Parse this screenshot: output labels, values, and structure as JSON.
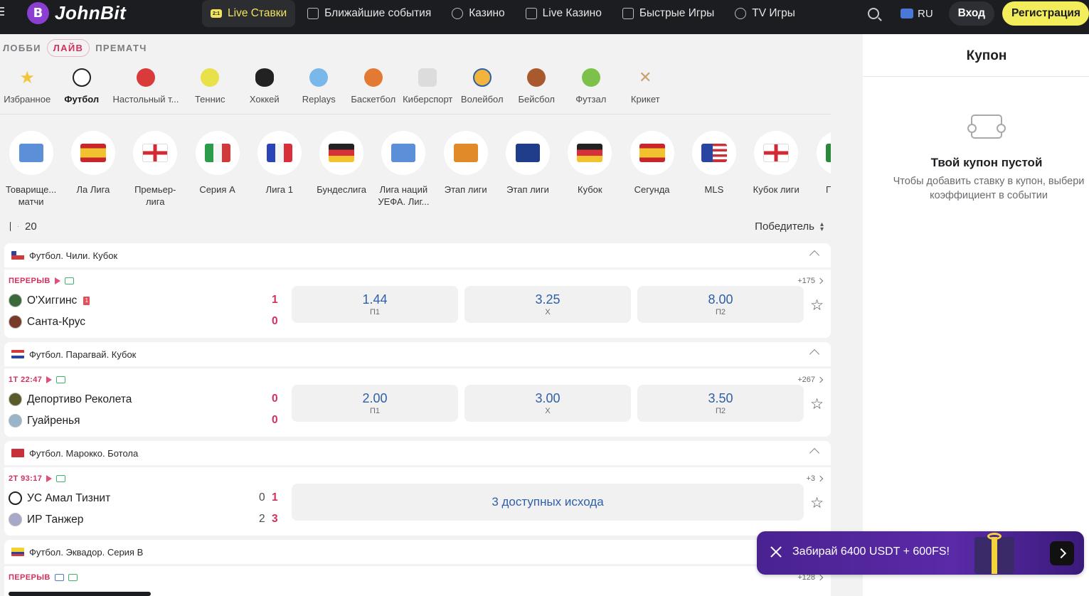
{
  "header": {
    "logo_text": "JohnBit",
    "nav": [
      {
        "label": "Live Ставки",
        "icon": "live-scoreboard-icon",
        "badge": "2:1",
        "active": true
      },
      {
        "label": "Ближайшие события",
        "icon": "calendar-icon"
      },
      {
        "label": "Казино",
        "icon": "casino-chip-icon"
      },
      {
        "label": "Live Казино",
        "icon": "live-casino-icon"
      },
      {
        "label": "Быстрые Игры",
        "icon": "rocket-icon"
      },
      {
        "label": "TV Игры",
        "icon": "tv-play-icon"
      }
    ],
    "language": "RU",
    "login_label": "Вход",
    "register_label": "Регистрация"
  },
  "modes": [
    {
      "label": "ЛОББИ"
    },
    {
      "label": "ЛАЙВ",
      "active": true
    },
    {
      "label": "ПРЕМАТЧ"
    }
  ],
  "sports": [
    {
      "label": "Избранное",
      "icon": "star-icon"
    },
    {
      "label": "Футбол",
      "icon": "soccer-ball-icon",
      "active": true
    },
    {
      "label": "Настольный т...",
      "icon": "table-tennis-icon"
    },
    {
      "label": "Теннис",
      "icon": "tennis-ball-icon"
    },
    {
      "label": "Хоккей",
      "icon": "hockey-puck-icon"
    },
    {
      "label": "Replays",
      "icon": "replay-icon"
    },
    {
      "label": "Баскетбол",
      "icon": "basketball-icon"
    },
    {
      "label": "Киберспорт",
      "icon": "gamepad-icon"
    },
    {
      "label": "Волейбол",
      "icon": "volleyball-icon"
    },
    {
      "label": "Бейсбол",
      "icon": "baseball-glove-icon"
    },
    {
      "label": "Футзал",
      "icon": "futsal-ball-icon"
    },
    {
      "label": "Крикет",
      "icon": "cricket-bats-icon"
    }
  ],
  "leagues": [
    {
      "label": "Товарище... матчи",
      "icon": "globe-icon"
    },
    {
      "label": "Ла Лига",
      "icon": "spain-flag-icon"
    },
    {
      "label": "Премьер-лига",
      "icon": "england-flag-icon"
    },
    {
      "label": "Серия А",
      "icon": "italy-flag-icon"
    },
    {
      "label": "Лига 1",
      "icon": "france-flag-icon"
    },
    {
      "label": "Бундеслига",
      "icon": "germany-flag-icon"
    },
    {
      "label": "Лига наций УЕФА. Лиг...",
      "icon": "globe-icon"
    },
    {
      "label": "Этап лиги",
      "icon": "europa-league-icon"
    },
    {
      "label": "Этап лиги",
      "icon": "champions-league-icon"
    },
    {
      "label": "Кубок",
      "icon": "germany-flag-icon"
    },
    {
      "label": "Сегунда",
      "icon": "spain-flag-icon"
    },
    {
      "label": "MLS",
      "icon": "usa-flag-icon"
    },
    {
      "label": "Кубок лиги",
      "icon": "england-flag-icon"
    },
    {
      "label": "При л",
      "icon": "portugal-flag-icon"
    }
  ],
  "list": {
    "count": "20",
    "sort_label": "Победитель"
  },
  "events": [
    {
      "title": "Футбол. Чили. Кубок",
      "status": "ПЕРЕРЫВ",
      "more": "+175",
      "team1": "О'Хиггинс",
      "team2": "Санта-Крус",
      "score1": "1",
      "score2": "0",
      "odds": [
        {
          "value": "1.44",
          "label": "П1"
        },
        {
          "value": "3.25",
          "label": "Х"
        },
        {
          "value": "8.00",
          "label": "П2"
        }
      ]
    },
    {
      "title": "Футбол. Парагвай. Кубок",
      "status": "1Т 22:47",
      "more": "+267",
      "team1": "Депортиво Реколета",
      "team2": "Гуайренья",
      "score1": "0",
      "score2": "0",
      "odds": [
        {
          "value": "2.00",
          "label": "П1"
        },
        {
          "value": "3.00",
          "label": "Х"
        },
        {
          "value": "3.50",
          "label": "П2"
        }
      ]
    },
    {
      "title": "Футбол. Марокко. Ботола",
      "status": "2Т 93:17",
      "more": "+3",
      "team1": "УС Амал Тизнит",
      "team2": "ИР Танжер",
      "half1": "0",
      "half2": "2",
      "score1": "1",
      "score2": "3",
      "outcomes": "3 доступных исхода"
    },
    {
      "title": "Футбол. Эквадор. Серия B",
      "status": "ПЕРЕРЫВ",
      "more": "+128"
    }
  ],
  "coupon": {
    "title": "Купон",
    "empty_title": "Твой купон пустой",
    "hint": "Чтобы добавить ставку в купон, выбери коэффициент в событии"
  },
  "promo": {
    "text": "Забирай 6400 USDT + 600FS!"
  },
  "colors": {
    "header_bg": "#1c1d21",
    "accent_yellow": "#f3ec5b",
    "live_red": "#d2305c",
    "odd_blue": "#2f5fa6",
    "promo_purple": "#4a2290"
  }
}
